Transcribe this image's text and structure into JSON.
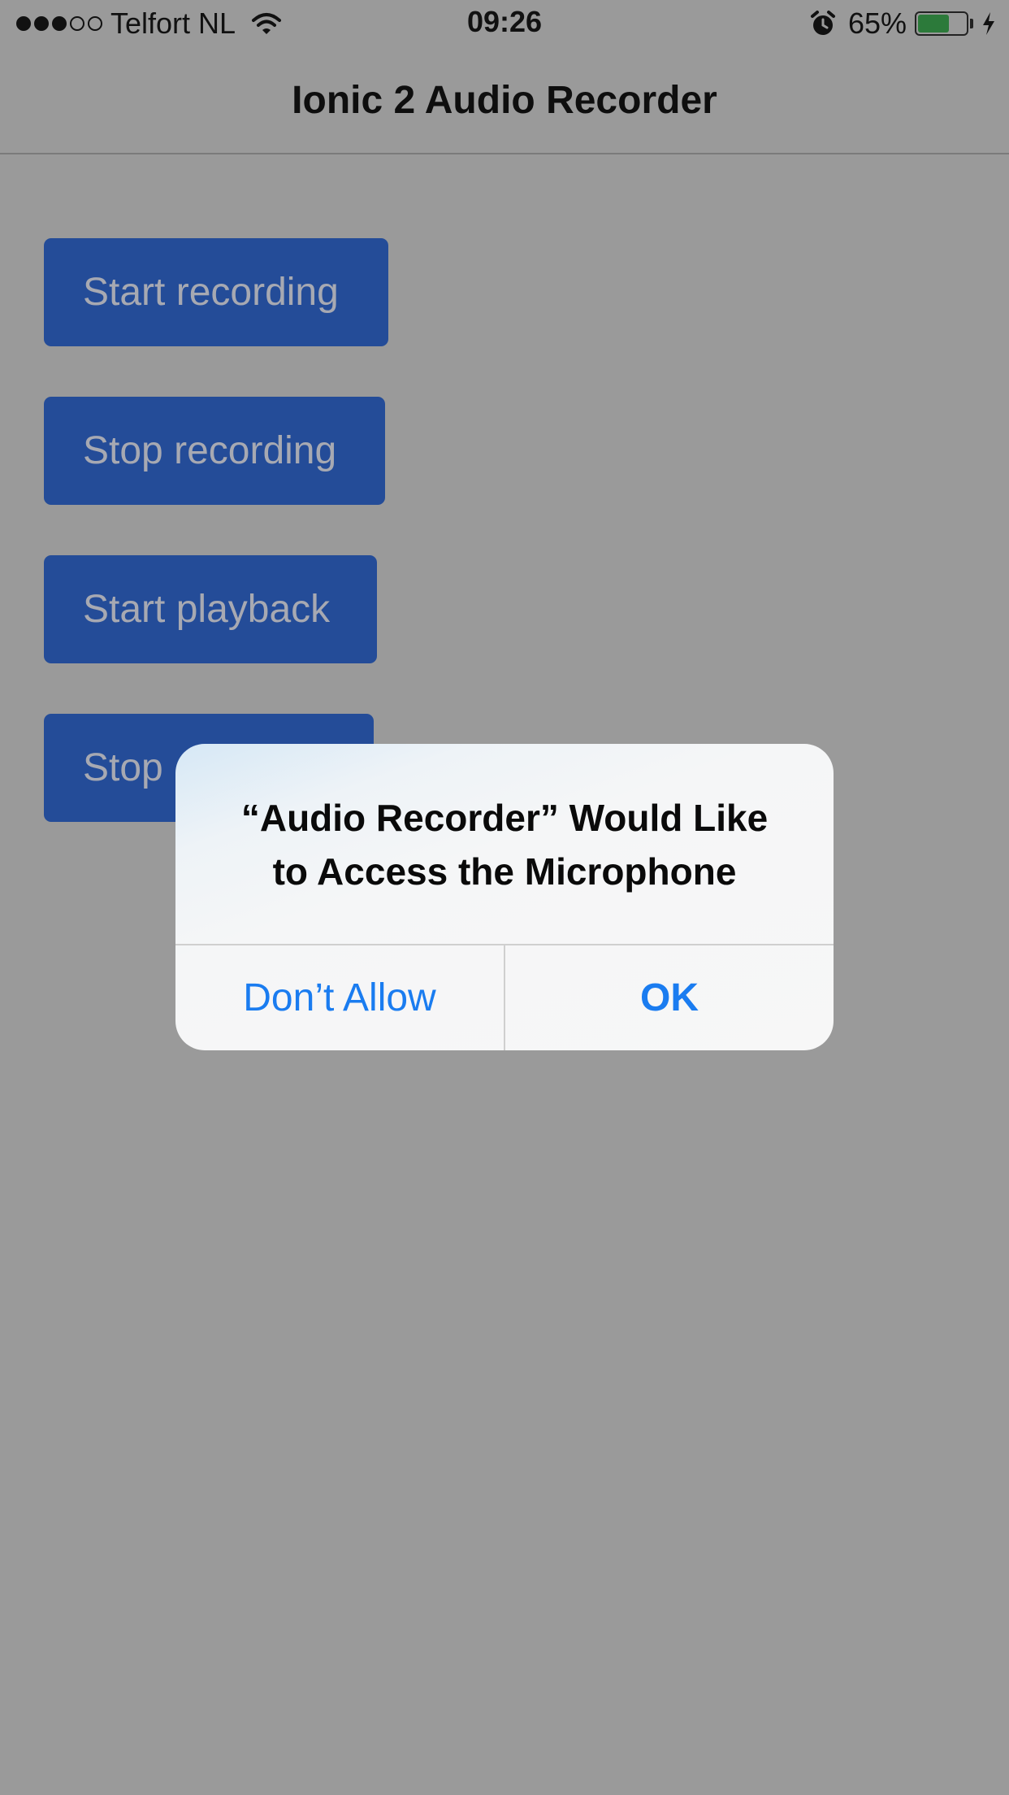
{
  "status_bar": {
    "carrier": "Telfort NL",
    "time": "09:26",
    "battery_percent": "65%",
    "battery_level": 0.65,
    "signal_bars_filled": 3,
    "signal_bars_total": 5,
    "icons": [
      "signal-dots-icon",
      "wifi-icon",
      "alarm-icon",
      "battery-icon",
      "charging-bolt-icon"
    ]
  },
  "header": {
    "title": "Ionic 2 Audio Recorder"
  },
  "buttons": [
    {
      "label": "Start recording"
    },
    {
      "label": "Stop recording"
    },
    {
      "label": "Start playback"
    },
    {
      "label": "Stop"
    }
  ],
  "dialog": {
    "title_line1": "“Audio Recorder” Would Like",
    "title_line2": "to Access the Microphone",
    "deny_label": "Don’t Allow",
    "ok_label": "OK"
  },
  "colors": {
    "background_dimmed": "#9a9a9a",
    "button": "#244c98",
    "dialog_action": "#1a7cf0",
    "battery": "#2c7a3a"
  }
}
